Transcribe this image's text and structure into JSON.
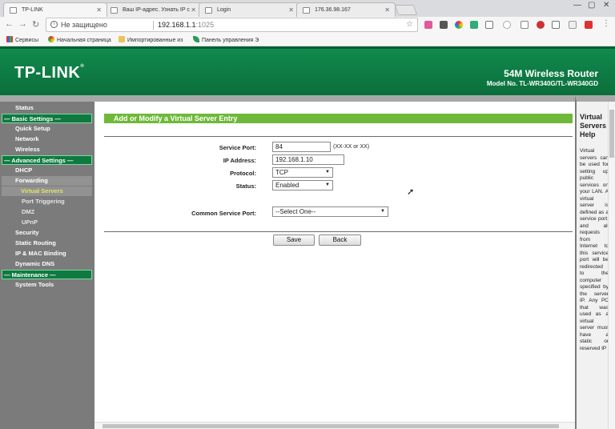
{
  "browser": {
    "tabs": [
      {
        "title": "TP-LINK"
      },
      {
        "title": "Ваш IP-адрес. Узнать IP с"
      },
      {
        "title": "Login"
      },
      {
        "title": "176.36.98.167"
      }
    ],
    "security": "Не защищено",
    "url_host": "192.168.1.1",
    "url_port": ":1025",
    "bookmarks": [
      {
        "label": "Сервисы",
        "icon": "apps-grid-icon"
      },
      {
        "label": "Начальная страница",
        "icon": "chrome-icon"
      },
      {
        "label": "Импортированные из",
        "icon": "folder-icon"
      },
      {
        "label": "Панель управления Э",
        "icon": "leaf-icon"
      }
    ]
  },
  "header": {
    "logo": "TP-LINK",
    "product": "54M Wireless Router",
    "model": "Model No. TL-WR340G/TL-WR340GD"
  },
  "sidebar": {
    "items": [
      {
        "label": "Status"
      },
      {
        "label": "— Basic Settings —"
      },
      {
        "label": "Quick Setup"
      },
      {
        "label": "Network"
      },
      {
        "label": "Wireless"
      },
      {
        "label": "— Advanced Settings —"
      },
      {
        "label": "DHCP"
      },
      {
        "label": "Forwarding"
      },
      {
        "label": "Virtual Servers"
      },
      {
        "label": "Port Triggering"
      },
      {
        "label": "DMZ"
      },
      {
        "label": "UPnP"
      },
      {
        "label": "Security"
      },
      {
        "label": "Static Routing"
      },
      {
        "label": "IP & MAC Binding"
      },
      {
        "label": "Dynamic DNS"
      },
      {
        "label": "— Maintenance —"
      },
      {
        "label": "System Tools"
      }
    ]
  },
  "form": {
    "title": "Add or Modify a Virtual Server Entry",
    "service_port_label": "Service Port:",
    "service_port_value": "84",
    "service_port_hint": "(XX-XX or XX)",
    "ip_label": "IP Address:",
    "ip_value": "192.168.1.10",
    "protocol_label": "Protocol:",
    "protocol_value": "TCP",
    "status_label": "Status:",
    "status_value": "Enabled",
    "common_port_label": "Common Service Port:",
    "common_port_value": "--Select One--",
    "save_label": "Save",
    "back_label": "Back"
  },
  "help": {
    "title": "Virtual Servers Help",
    "text": "Virtual servers can be used for setting up public services on your LAN. A virtual server is defined as a service port, and all requests from Internet to this service port will be redirected to the computer specified by the server IP. Any PC that was used as a virtual server must have a static or reserved IP"
  }
}
